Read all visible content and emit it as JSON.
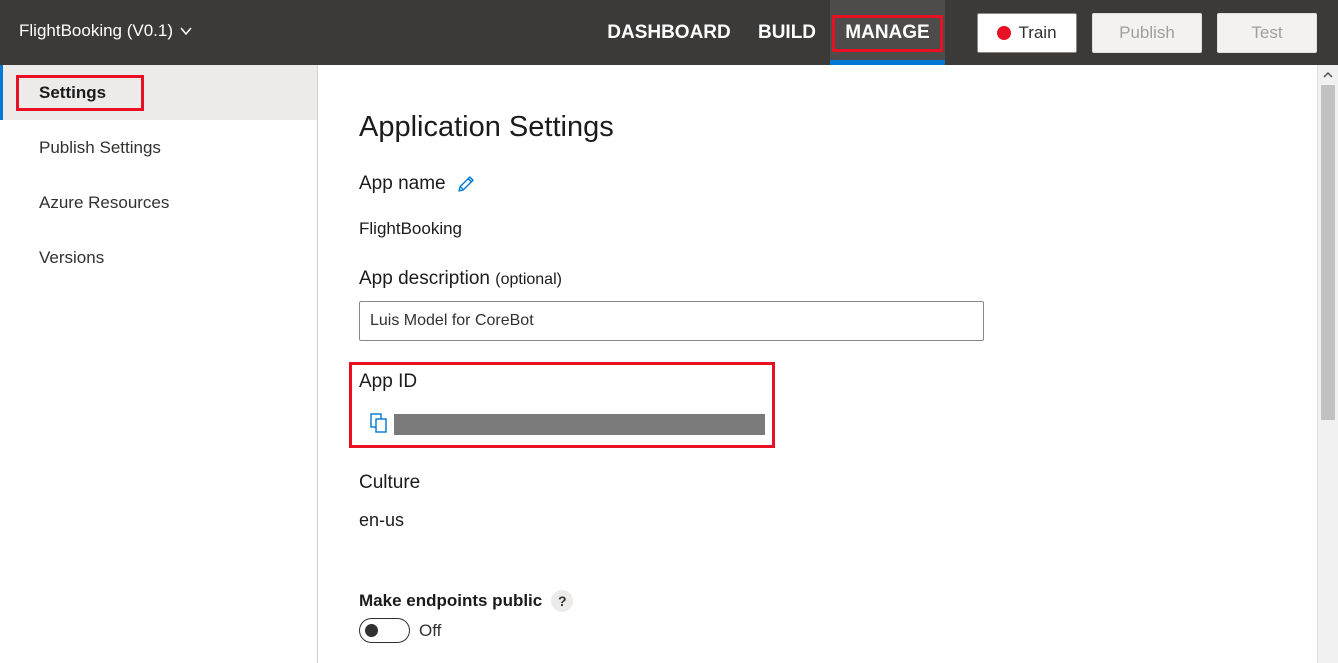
{
  "header": {
    "app_title": "FlightBooking (V0.1)",
    "tabs": [
      {
        "label": "DASHBOARD"
      },
      {
        "label": "BUILD"
      },
      {
        "label": "MANAGE",
        "active": true
      }
    ],
    "buttons": {
      "train": "Train",
      "publish": "Publish",
      "test": "Test"
    }
  },
  "sidebar": {
    "items": [
      {
        "label": "Settings",
        "active": true
      },
      {
        "label": "Publish Settings"
      },
      {
        "label": "Azure Resources"
      },
      {
        "label": "Versions"
      }
    ]
  },
  "main": {
    "title": "Application Settings",
    "app_name_label": "App name",
    "app_name_value": "FlightBooking",
    "app_description_label": "App description",
    "app_description_optional": "(optional)",
    "app_description_value": "Luis Model for CoreBot",
    "app_id_label": "App ID",
    "culture_label": "Culture",
    "culture_value": "en-us",
    "endpoints_label": "Make endpoints public",
    "help_glyph": "?",
    "endpoints_state": "Off"
  },
  "colors": {
    "topbar": "#3b3a39",
    "accent": "#0078d4",
    "highlight": "#e81123",
    "train_dot": "#e81123"
  },
  "icons": [
    "chevron-down-icon",
    "pencil-icon",
    "copy-icon",
    "help-icon",
    "scroll-up-icon"
  ]
}
